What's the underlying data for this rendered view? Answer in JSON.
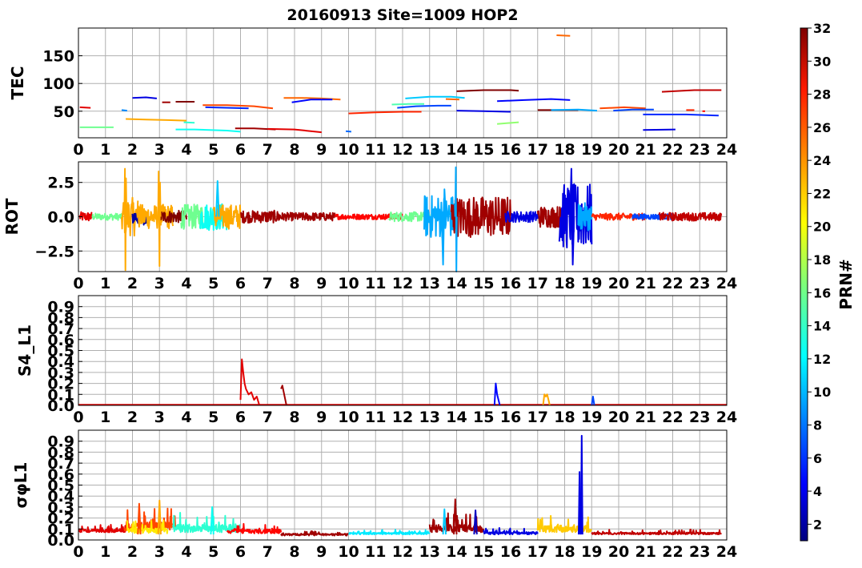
{
  "figure": {
    "title": "20160913 Site=1009 HOP2",
    "colorbar": {
      "label": "PRN#",
      "min": 1,
      "max": 32,
      "ticks": [
        "2",
        "4",
        "6",
        "8",
        "10",
        "12",
        "14",
        "16",
        "18",
        "20",
        "22",
        "24",
        "26",
        "28",
        "30",
        "32"
      ]
    }
  },
  "chart_data": [
    {
      "type": "line",
      "ylabel": "TEC",
      "xlim": [
        0,
        24
      ],
      "ylim": [
        2,
        200
      ],
      "xticks": [
        "0",
        "1",
        "2",
        "3",
        "4",
        "5",
        "6",
        "7",
        "8",
        "9",
        "10",
        "11",
        "12",
        "13",
        "14",
        "15",
        "16",
        "17",
        "18",
        "19",
        "20",
        "21",
        "22",
        "23",
        "24"
      ],
      "yticks": [
        {
          "v": 50,
          "t": "50"
        },
        {
          "v": 100,
          "t": "100"
        },
        {
          "v": 150,
          "t": "150"
        }
      ],
      "grid": true,
      "series": [
        {
          "prn": 29,
          "x": [
            0.05,
            0.45
          ],
          "y": [
            57,
            56
          ]
        },
        {
          "prn": 16,
          "x": [
            0.05,
            1.3
          ],
          "y": [
            21,
            21
          ]
        },
        {
          "prn": 9,
          "x": [
            1.6,
            1.8
          ],
          "y": [
            52,
            51
          ]
        },
        {
          "prn": 23,
          "x": [
            1.75,
            2.5,
            3.3,
            4.0
          ],
          "y": [
            36,
            35,
            34,
            33
          ]
        },
        {
          "prn": 4,
          "x": [
            2.0,
            2.5,
            2.9
          ],
          "y": [
            74,
            75,
            73
          ]
        },
        {
          "prn": 31,
          "x": [
            3.1,
            3.4
          ],
          "y": [
            66,
            66
          ]
        },
        {
          "prn": 32,
          "x": [
            3.6,
            4.3
          ],
          "y": [
            67,
            67
          ]
        },
        {
          "prn": 13,
          "x": [
            3.6,
            4.3,
            5.5,
            6.0
          ],
          "y": [
            17,
            17,
            15,
            13
          ]
        },
        {
          "prn": 14,
          "x": [
            3.9,
            4.3
          ],
          "y": [
            30,
            29
          ]
        },
        {
          "prn": 26,
          "x": [
            4.6,
            5.5,
            6.5,
            7.2
          ],
          "y": [
            61,
            61,
            59,
            55
          ]
        },
        {
          "prn": 6,
          "x": [
            4.7,
            5.6,
            6.3
          ],
          "y": [
            57,
            56,
            55
          ]
        },
        {
          "prn": 31,
          "x": [
            5.8,
            6.5,
            7.3
          ],
          "y": [
            19,
            19,
            17
          ]
        },
        {
          "prn": 29,
          "x": [
            7.0,
            8.0,
            9.0
          ],
          "y": [
            18,
            17,
            12
          ]
        },
        {
          "prn": 25,
          "x": [
            7.6,
            8.3,
            9.0,
            9.7
          ],
          "y": [
            74,
            74,
            73,
            71
          ]
        },
        {
          "prn": 5,
          "x": [
            7.9,
            8.6,
            9.4
          ],
          "y": [
            66,
            71,
            71
          ]
        },
        {
          "prn": 8,
          "x": [
            9.9,
            10.1
          ],
          "y": [
            14,
            13
          ]
        },
        {
          "prn": 27,
          "x": [
            10.0,
            11.0,
            12.0,
            12.7
          ],
          "y": [
            46,
            48,
            49,
            49
          ]
        },
        {
          "prn": 15,
          "x": [
            11.6,
            12.2,
            12.8
          ],
          "y": [
            62,
            63,
            63
          ]
        },
        {
          "prn": 7,
          "x": [
            11.8,
            12.5,
            13.3,
            13.8
          ],
          "y": [
            56,
            59,
            60,
            60
          ]
        },
        {
          "prn": 11,
          "x": [
            12.1,
            13.0,
            13.8,
            14.3
          ],
          "y": [
            73,
            76,
            76,
            74
          ]
        },
        {
          "prn": 25,
          "x": [
            13.6,
            14.1
          ],
          "y": [
            72,
            71
          ]
        },
        {
          "prn": 32,
          "x": [
            14.0,
            15.0,
            16.0,
            16.3
          ],
          "y": [
            86,
            88,
            88,
            87
          ]
        },
        {
          "prn": 4,
          "x": [
            14.0,
            15.0,
            16.0
          ],
          "y": [
            51,
            50,
            49
          ]
        },
        {
          "prn": 17,
          "x": [
            15.5,
            16.3
          ],
          "y": [
            27,
            30
          ]
        },
        {
          "prn": 5,
          "x": [
            15.5,
            16.5,
            17.5,
            18.2
          ],
          "y": [
            68,
            70,
            72,
            70
          ]
        },
        {
          "prn": 32,
          "x": [
            17.0,
            17.8,
            18.5
          ],
          "y": [
            52,
            52,
            52
          ]
        },
        {
          "prn": 25,
          "x": [
            17.7,
            18.2
          ],
          "y": [
            187,
            186
          ]
        },
        {
          "prn": 10,
          "x": [
            17.5,
            18.5,
            19.2
          ],
          "y": [
            52,
            53,
            51
          ]
        },
        {
          "prn": 26,
          "x": [
            19.3,
            20.2,
            21.0
          ],
          "y": [
            55,
            57,
            55
          ]
        },
        {
          "prn": 7,
          "x": [
            19.8,
            20.5,
            21.3
          ],
          "y": [
            51,
            53,
            53
          ]
        },
        {
          "prn": 6,
          "x": [
            20.9,
            22.5,
            23.7
          ],
          "y": [
            44,
            44,
            42
          ]
        },
        {
          "prn": 4,
          "x": [
            20.9,
            22.1
          ],
          "y": [
            16,
            17
          ]
        },
        {
          "prn": 30,
          "x": [
            21.6,
            22.8,
            23.8
          ],
          "y": [
            85,
            88,
            88
          ]
        },
        {
          "prn": 27,
          "x": [
            22.5,
            22.8
          ],
          "y": [
            52,
            52
          ]
        },
        {
          "prn": 28,
          "x": [
            23.1,
            23.2
          ],
          "y": [
            50,
            50
          ]
        }
      ]
    },
    {
      "type": "line",
      "ylabel": "ROT",
      "xlim": [
        0,
        24
      ],
      "ylim": [
        -4,
        4
      ],
      "xticks": [
        "0",
        "1",
        "2",
        "3",
        "4",
        "5",
        "6",
        "7",
        "8",
        "9",
        "10",
        "11",
        "12",
        "13",
        "14",
        "15",
        "16",
        "17",
        "18",
        "19",
        "20",
        "21",
        "22",
        "23",
        "24"
      ],
      "yticks": [
        {
          "v": 2.5,
          "t": "2.5"
        },
        {
          "v": 0,
          "t": "0.0"
        },
        {
          "v": -2.5,
          "t": "−2.5"
        }
      ],
      "grid": true,
      "noise": [
        {
          "prn": 29,
          "x0": 0.05,
          "x1": 0.5,
          "a": 0.35
        },
        {
          "prn": 16,
          "x0": 0.5,
          "x1": 1.6,
          "a": 0.25
        },
        {
          "prn": 23,
          "x0": 1.6,
          "x1": 2.2,
          "a": 1.4
        },
        {
          "prn": 2,
          "x0": 2.0,
          "x1": 2.6,
          "a": 0.6
        },
        {
          "prn": 23,
          "x0": 2.2,
          "x1": 3.5,
          "a": 0.9
        },
        {
          "prn": 32,
          "x0": 3.0,
          "x1": 4.0,
          "a": 0.45
        },
        {
          "prn": 16,
          "x0": 3.8,
          "x1": 4.6,
          "a": 0.9
        },
        {
          "prn": 13,
          "x0": 4.5,
          "x1": 5.5,
          "a": 1.0
        },
        {
          "prn": 23,
          "x0": 5.0,
          "x1": 6.0,
          "a": 0.9
        },
        {
          "prn": 31,
          "x0": 6.0,
          "x1": 7.5,
          "a": 0.45
        },
        {
          "prn": 31,
          "x0": 7.5,
          "x1": 9.5,
          "a": 0.3
        },
        {
          "prn": 28,
          "x0": 9.5,
          "x1": 12.0,
          "a": 0.2
        },
        {
          "prn": 16,
          "x0": 11.5,
          "x1": 13.0,
          "a": 0.35
        },
        {
          "prn": 10,
          "x0": 12.8,
          "x1": 14.0,
          "a": 1.6
        },
        {
          "prn": 31,
          "x0": 13.8,
          "x1": 16.0,
          "a": 1.5
        },
        {
          "prn": 4,
          "x0": 15.8,
          "x1": 17.0,
          "a": 0.4
        },
        {
          "prn": 31,
          "x0": 17.0,
          "x1": 18.0,
          "a": 0.8
        },
        {
          "prn": 4,
          "x0": 17.8,
          "x1": 19.0,
          "a": 2.4
        },
        {
          "prn": 10,
          "x0": 18.5,
          "x1": 19.0,
          "a": 1.0
        },
        {
          "prn": 27,
          "x0": 19.0,
          "x1": 21.0,
          "a": 0.25
        },
        {
          "prn": 7,
          "x0": 20.5,
          "x1": 22.0,
          "a": 0.2
        },
        {
          "prn": 30,
          "x0": 21.5,
          "x1": 23.8,
          "a": 0.3
        }
      ],
      "spikes": [
        {
          "prn": 23,
          "x": [
            1.7,
            1.72,
            1.74,
            1.76,
            1.78
          ],
          "y": [
            0,
            3.5,
            -3.9,
            2.8,
            0
          ]
        },
        {
          "prn": 23,
          "x": [
            2.95,
            2.97,
            3.0,
            3.02,
            3.04
          ],
          "y": [
            0,
            3.3,
            -3.6,
            2.5,
            0
          ]
        },
        {
          "prn": 10,
          "x": [
            13.95,
            13.97,
            13.99,
            14.01
          ],
          "y": [
            0,
            3.6,
            -4.0,
            0
          ]
        },
        {
          "prn": 10,
          "x": [
            13.45,
            13.5,
            13.55,
            13.6
          ],
          "y": [
            0,
            -3.5,
            2.0,
            0
          ]
        },
        {
          "prn": 4,
          "x": [
            18.2,
            18.25,
            18.3,
            18.35
          ],
          "y": [
            0,
            3.5,
            -3.5,
            0
          ]
        },
        {
          "prn": 11,
          "x": [
            5.1,
            5.15,
            5.2
          ],
          "y": [
            0,
            2.6,
            0
          ]
        }
      ]
    },
    {
      "type": "line",
      "ylabel": "S4_L1",
      "xlim": [
        0,
        24
      ],
      "ylim": [
        0,
        1.0
      ],
      "xticks": [
        "0",
        "1",
        "2",
        "3",
        "4",
        "5",
        "6",
        "7",
        "8",
        "9",
        "10",
        "11",
        "12",
        "13",
        "14",
        "15",
        "16",
        "17",
        "18",
        "19",
        "20",
        "21",
        "22",
        "23",
        "24"
      ],
      "yticks": [
        {
          "v": 0,
          "t": "0.0"
        },
        {
          "v": 0.1,
          "t": "0.1"
        },
        {
          "v": 0.2,
          "t": "0.2"
        },
        {
          "v": 0.3,
          "t": "0.3"
        },
        {
          "v": 0.4,
          "t": "0.4"
        },
        {
          "v": 0.5,
          "t": "0.5"
        },
        {
          "v": 0.6,
          "t": "0.6"
        },
        {
          "v": 0.7,
          "t": "0.7"
        },
        {
          "v": 0.8,
          "t": "0.8"
        },
        {
          "v": 0.9,
          "t": "0.9"
        }
      ],
      "grid": true,
      "series": [
        {
          "prn": 29,
          "x": [
            0.0,
            24.0
          ],
          "y": [
            0.005,
            0.005
          ]
        },
        {
          "prn": 29,
          "x": [
            6.0,
            6.05,
            6.1,
            6.15,
            6.2,
            6.3,
            6.4,
            6.5,
            6.6,
            6.7
          ],
          "y": [
            0.05,
            0.42,
            0.3,
            0.2,
            0.15,
            0.1,
            0.12,
            0.05,
            0.08,
            0.0
          ]
        },
        {
          "prn": 31,
          "x": [
            7.5,
            7.55,
            7.6,
            7.65,
            7.7
          ],
          "y": [
            0.15,
            0.18,
            0.12,
            0.06,
            0.0
          ]
        },
        {
          "prn": 5,
          "x": [
            15.4,
            15.45,
            15.5,
            15.55,
            15.6
          ],
          "y": [
            0.0,
            0.2,
            0.1,
            0.05,
            0.0
          ]
        },
        {
          "prn": 23,
          "x": [
            17.2,
            17.25,
            17.3,
            17.35,
            17.4,
            17.45
          ],
          "y": [
            0.0,
            0.1,
            0.08,
            0.1,
            0.05,
            0.0
          ]
        },
        {
          "prn": 7,
          "x": [
            19.0,
            19.05,
            19.1
          ],
          "y": [
            0.0,
            0.08,
            0.0
          ]
        }
      ]
    },
    {
      "type": "line",
      "ylabel": "σφL1",
      "xlim": [
        0,
        24
      ],
      "ylim": [
        0,
        1.0
      ],
      "xticks": [
        "0",
        "1",
        "2",
        "3",
        "4",
        "5",
        "6",
        "7",
        "8",
        "9",
        "10",
        "11",
        "12",
        "13",
        "14",
        "15",
        "16",
        "17",
        "18",
        "19",
        "20",
        "21",
        "22",
        "23",
        "24"
      ],
      "yticks": [
        {
          "v": 0,
          "t": "0.0"
        },
        {
          "v": 0.1,
          "t": "0.1"
        },
        {
          "v": 0.2,
          "t": "0.2"
        },
        {
          "v": 0.3,
          "t": "0.3"
        },
        {
          "v": 0.4,
          "t": "0.4"
        },
        {
          "v": 0.5,
          "t": "0.5"
        },
        {
          "v": 0.6,
          "t": "0.6"
        },
        {
          "v": 0.7,
          "t": "0.7"
        },
        {
          "v": 0.8,
          "t": "0.8"
        },
        {
          "v": 0.9,
          "t": "0.9"
        }
      ],
      "grid": true,
      "noise": [
        {
          "prn": 29,
          "x0": 0.0,
          "x1": 1.8,
          "a": 0.05,
          "base": 0.07
        },
        {
          "prn": 26,
          "x0": 1.7,
          "x1": 3.6,
          "a": 0.14,
          "base": 0.08
        },
        {
          "prn": 21,
          "x0": 1.8,
          "x1": 3.3,
          "a": 0.08,
          "base": 0.06
        },
        {
          "prn": 14,
          "x0": 3.5,
          "x1": 6.0,
          "a": 0.12,
          "base": 0.07
        },
        {
          "prn": 28,
          "x0": 5.5,
          "x1": 7.5,
          "a": 0.06,
          "base": 0.06
        },
        {
          "prn": 31,
          "x0": 7.5,
          "x1": 10.0,
          "a": 0.03,
          "base": 0.04
        },
        {
          "prn": 12,
          "x0": 10.0,
          "x1": 13.0,
          "a": 0.03,
          "base": 0.05
        },
        {
          "prn": 31,
          "x0": 13.0,
          "x1": 15.0,
          "a": 0.12,
          "base": 0.07
        },
        {
          "prn": 4,
          "x0": 15.0,
          "x1": 17.0,
          "a": 0.04,
          "base": 0.05
        },
        {
          "prn": 22,
          "x0": 17.0,
          "x1": 19.0,
          "a": 0.1,
          "base": 0.07
        },
        {
          "prn": 30,
          "x0": 19.0,
          "x1": 23.8,
          "a": 0.03,
          "base": 0.05
        }
      ],
      "spikes": [
        {
          "prn": 23,
          "x": [
            2.95,
            3.0,
            3.05
          ],
          "y": [
            0.05,
            0.36,
            0.05
          ]
        },
        {
          "prn": 26,
          "x": [
            2.2,
            2.25,
            2.3
          ],
          "y": [
            0.05,
            0.33,
            0.05
          ]
        },
        {
          "prn": 13,
          "x": [
            4.9,
            4.95,
            5.0
          ],
          "y": [
            0.05,
            0.3,
            0.05
          ]
        },
        {
          "prn": 31,
          "x": [
            13.9,
            13.95,
            14.0
          ],
          "y": [
            0.05,
            0.37,
            0.05
          ]
        },
        {
          "prn": 4,
          "x": [
            18.52,
            18.55,
            18.58
          ],
          "y": [
            0.05,
            0.62,
            0.05
          ]
        },
        {
          "prn": 4,
          "x": [
            18.6,
            18.63,
            18.66
          ],
          "y": [
            0.05,
            0.95,
            0.05
          ]
        },
        {
          "prn": 11,
          "x": [
            13.5,
            13.55,
            13.6
          ],
          "y": [
            0.05,
            0.28,
            0.05
          ]
        },
        {
          "prn": 3,
          "x": [
            14.65,
            14.7,
            14.75
          ],
          "y": [
            0.05,
            0.27,
            0.05
          ]
        }
      ]
    }
  ]
}
